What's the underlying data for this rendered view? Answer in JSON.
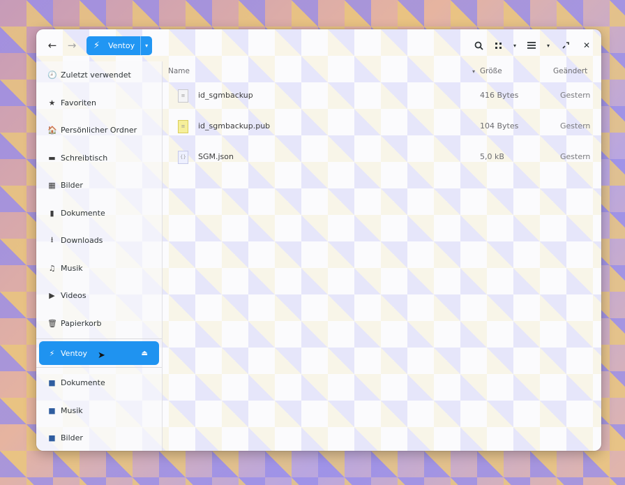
{
  "header": {
    "back_icon": "←",
    "forward_icon": "→",
    "location_icon": "usb-icon",
    "location_label": "Ventoy",
    "location_dropdown": "▾",
    "search_icon": "search-icon",
    "view_icon": "grid-view-icon",
    "menu_icon": "hamburger-menu-icon",
    "restore_icon": "restore-icon",
    "close_icon": "✕"
  },
  "sidebar": {
    "items": [
      {
        "label": "Zuletzt verwendet",
        "icon": "🕘"
      },
      {
        "label": "Favoriten",
        "icon": "★"
      },
      {
        "label": "Persönlicher Ordner",
        "icon": "🏠"
      },
      {
        "label": "Schreibtisch",
        "icon": "▬"
      },
      {
        "label": "Bilder",
        "icon": "▦"
      },
      {
        "label": "Dokumente",
        "icon": "▮"
      },
      {
        "label": "Downloads",
        "icon": "⭳"
      },
      {
        "label": "Musik",
        "icon": "♫"
      },
      {
        "label": "Videos",
        "icon": "▶"
      },
      {
        "label": "Papierkorb",
        "icon": "🗑"
      }
    ],
    "active_device": {
      "label": "Ventoy",
      "icon": "⚡",
      "eject": "⏏"
    },
    "bookmarks": [
      {
        "label": "Dokumente",
        "icon": "■"
      },
      {
        "label": "Musik",
        "icon": "■"
      },
      {
        "label": "Bilder",
        "icon": "■"
      }
    ]
  },
  "columns": {
    "name": "Name",
    "sort_indicator": "▾",
    "size": "Größe",
    "modified": "Geändert"
  },
  "files": [
    {
      "name": "id_sgmbackup",
      "size": "416 Bytes",
      "modified": "Gestern",
      "type": "key"
    },
    {
      "name": "id_sgmbackup.pub",
      "size": "104 Bytes",
      "modified": "Gestern",
      "type": "pub"
    },
    {
      "name": "SGM.json",
      "size": "5,0 kB",
      "modified": "Gestern",
      "type": "json"
    }
  ]
}
